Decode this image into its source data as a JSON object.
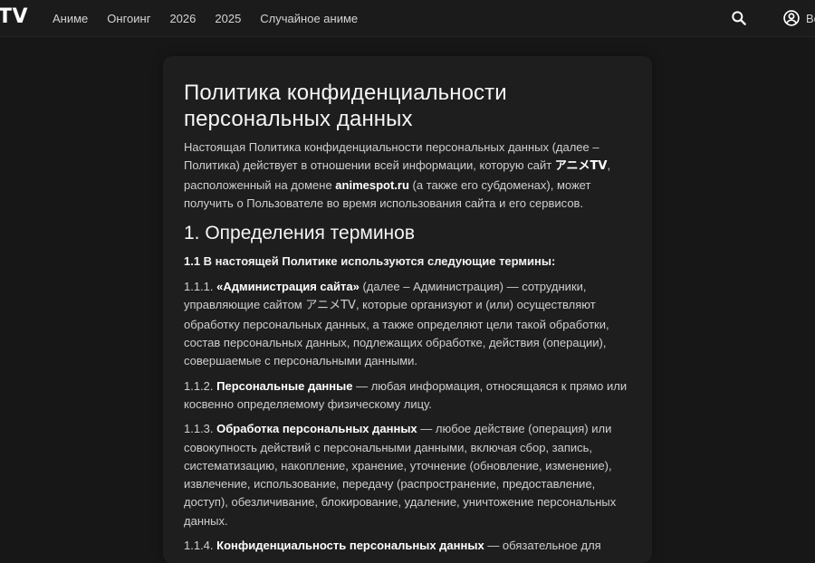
{
  "header": {
    "logo_text": "TV",
    "nav": [
      "Аниме",
      "Онгоинг",
      "2026",
      "2025",
      "Случайное аниме"
    ],
    "login_label": "Во",
    "icons": {
      "search": "search-icon",
      "account": "account-circle-icon"
    }
  },
  "page": {
    "title": "Политика конфиденциальности персональных данных",
    "intro": {
      "part1": "Настоящая Политика конфиденциальности персональных данных (далее – Политика) действует в отношении всей информации, которую сайт ",
      "site_name": "アニメTV",
      "part2": ", расположенный на домене ",
      "domain": "animespot.ru",
      "part3": " (а также его субдоменах), может получить о Пользователе во время использования сайта и его сервисов."
    },
    "section1": {
      "heading": "1. Определения терминов",
      "subheading": "1.1 В настоящей Политике используются следующие термины:",
      "terms": [
        {
          "num": "1.1.1. ",
          "term": "«Администрация сайта»",
          "text_before": " (далее – Администрация) — сотрудники, управляющие сайтом ",
          "site": "アニメTV",
          "text_after": ", которые организуют и (или) осуществляют обработку персональных данных, а также определяют цели такой обработки, состав персональных данных, подлежащих обработке, действия (операции), совершаемые с персональными данными."
        },
        {
          "num": "1.1.2. ",
          "term": "Персональные данные",
          "text": " — любая информация, относящаяся к прямо или косвенно определяемому физическому лицу."
        },
        {
          "num": "1.1.3. ",
          "term": "Обработка персональных данных",
          "text": " — любое действие (операция) или совокупность действий с персональными данными, включая сбор, запись, систематизацию, накопление, хранение, уточнение (обновление, изменение), извлечение, использование, передачу (распространение, предоставление, доступ), обезличивание, блокирование, удаление, уничтожение персональных данных."
        },
        {
          "num": "1.1.4. ",
          "term": "Конфиденциальность персональных данных",
          "text": " — обязательное для"
        }
      ]
    }
  },
  "colors": {
    "background": "#171717",
    "header_bg": "#1b1b1b",
    "card_bg": "#1e1e1e",
    "text": "#cfcfcf",
    "heading": "#f5f5f5"
  }
}
